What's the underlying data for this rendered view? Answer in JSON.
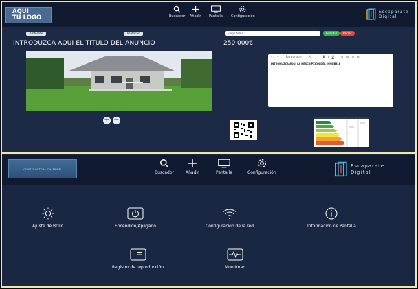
{
  "top": {
    "logo": "AQUI\nTU LOGO",
    "nav": [
      {
        "icon": "search-icon",
        "label": "Buscador"
      },
      {
        "icon": "plus-icon",
        "label": "Añadir"
      },
      {
        "icon": "monitor-icon",
        "label": "Pantalla"
      },
      {
        "icon": "gear-icon",
        "label": "Configuración"
      }
    ],
    "brand": {
      "line1": "Escaparate",
      "line2": "Digital"
    },
    "chips": {
      "left": "Ambiente",
      "right": "Pantallas"
    },
    "ad_title": "INTRODUZCA AQUI EL TITULO DEL ANUNCIO",
    "price": "250.000€",
    "select_placeholder": "Elegir tema...",
    "btn_save": "Guardar",
    "btn_delete": "Borrar",
    "editor_toolbar": [
      "↶",
      "↷",
      "Paragraph",
      "A",
      "B",
      "I",
      "U",
      "≡",
      "≡",
      "≡",
      "≡"
    ],
    "editor_text": "INTRODUZCA AQUI LA DESCRIPCION DEL INMUEBLE",
    "photo_controls": [
      "+",
      "−"
    ]
  },
  "bottom": {
    "logo": "CONSTRUCTORA CHAMBERI",
    "nav": [
      {
        "icon": "search-icon",
        "label": "Buscador"
      },
      {
        "icon": "plus-icon",
        "label": "Añadir"
      },
      {
        "icon": "monitor-icon",
        "label": "Pantalla"
      },
      {
        "icon": "gear-icon",
        "label": "Configuración"
      }
    ],
    "brand": {
      "line1": "Escaparate",
      "line2": "Digital"
    },
    "settings": [
      {
        "icon": "brightness-icon",
        "label": "Ajuste de Brillo"
      },
      {
        "icon": "power-icon",
        "label": "Encendido/Apagado"
      },
      {
        "icon": "wifi-icon",
        "label": "Configuración de la red"
      },
      {
        "icon": "info-icon",
        "label": "Información de Pantalla"
      },
      {
        "icon": "log-icon",
        "label": "Registro de reproducción"
      },
      {
        "icon": "monitoring-icon",
        "label": "Monitoreo"
      }
    ]
  },
  "colors": {
    "accent_green": "#33b44a",
    "accent_red": "#e0473e",
    "frame": "#efe6a8",
    "background": "#1c2a45"
  }
}
